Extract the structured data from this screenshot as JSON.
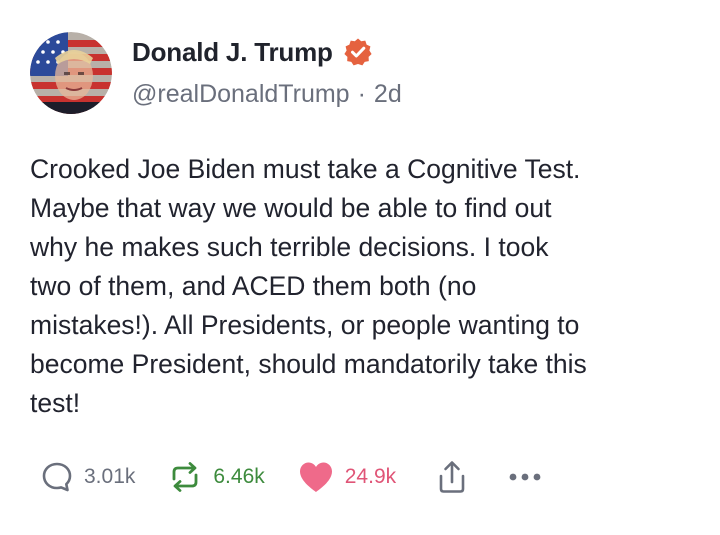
{
  "author": {
    "display_name": "Donald J. Trump",
    "handle": "@realDonaldTrump",
    "separator": "·",
    "time_ago": "2d",
    "verified_icon": "verified-badge-icon",
    "verified_color": "#e5623f"
  },
  "post": {
    "text": "Crooked Joe Biden must take a Cognitive Test.\nMaybe that way we would be able to find out\nwhy he makes such terrible  decisions. I took\ntwo of them, and ACED them both (no\nmistakes!). All Presidents, or people wanting to\nbecome President, should mandatorily take this\ntest!"
  },
  "actions": {
    "reply": {
      "icon": "comment-icon",
      "count": "3.01k",
      "color": "#6a6f7c"
    },
    "repost": {
      "icon": "repost-icon",
      "count": "6.46k",
      "color": "#3d8b3d"
    },
    "like": {
      "icon": "heart-icon",
      "count": "24.9k",
      "color": "#e05577"
    },
    "share": {
      "icon": "share-icon"
    },
    "more": {
      "icon": "more-options-icon"
    }
  }
}
